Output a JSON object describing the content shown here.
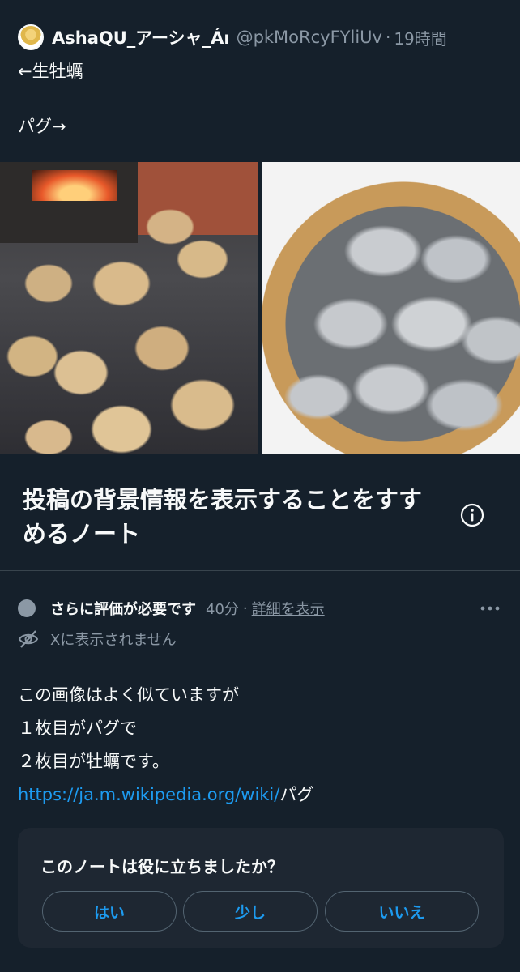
{
  "post": {
    "author_name": "AshaQU_アーシャ_Áı",
    "author_handle": "@pkMoRcyFYliUv",
    "separator": "·",
    "time": "19時間",
    "line1": "←生牡蠣",
    "line2": "パグ→"
  },
  "images": [
    {
      "subject": "pugs"
    },
    {
      "subject": "oysters"
    }
  ],
  "note": {
    "title": "投稿の背景情報を表示することをすすめるノート",
    "status_label": "さらに評価が必要です",
    "time": "40分",
    "separator": "·",
    "details_link": "詳細を表示",
    "hidden_label": "Xに表示されません",
    "body_lines": [
      "この画像はよく似ていますが",
      "１枚目がパグで",
      "２枚目が牡蠣です。"
    ],
    "link_text": "https://ja.m.wikipedia.org/wiki/",
    "link_suffix": "パグ"
  },
  "rating": {
    "question": "このノートは役に立ちましたか？",
    "buttons": {
      "yes": "はい",
      "some": "少し",
      "no": "いいえ"
    }
  },
  "colors": {
    "background": "#15202b",
    "card": "#1e2732",
    "accent": "#1d9bf0",
    "muted": "#8b98a5",
    "text": "#f7f9f9"
  },
  "icons": [
    "info-icon",
    "more-icon",
    "eye-off-icon",
    "status-dot"
  ]
}
